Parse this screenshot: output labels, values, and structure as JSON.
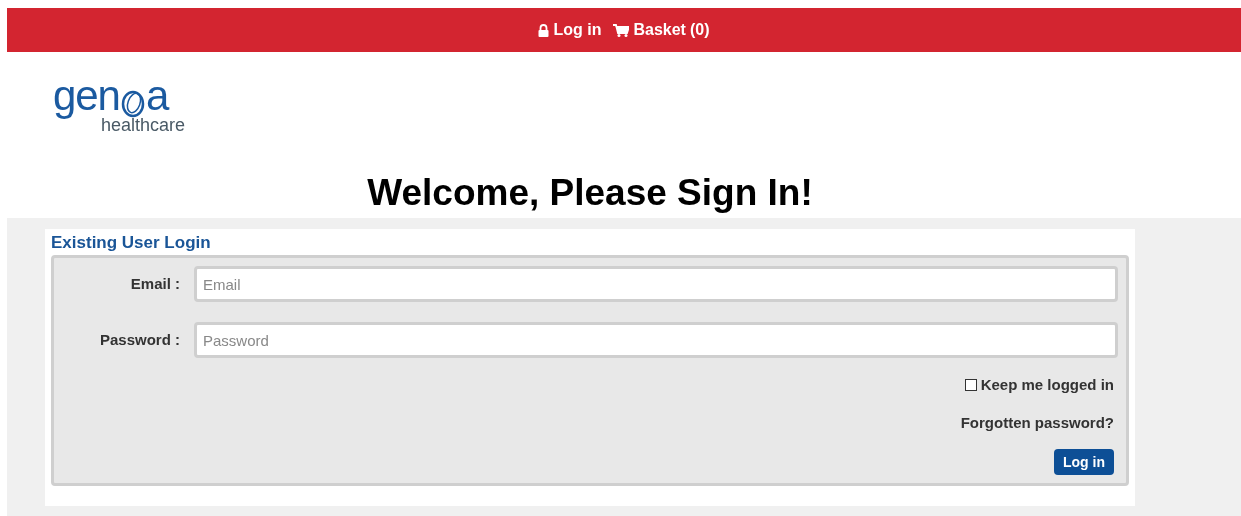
{
  "top_bar": {
    "login": "Log in",
    "basket": "Basket",
    "basket_count": "(0)"
  },
  "logo": {
    "word_start": "gen",
    "word_end": "a",
    "tagline": "healthcare"
  },
  "heading": "Welcome, Please Sign In!",
  "login_panel": {
    "title": "Existing User Login",
    "fields": [
      {
        "label": "Email :",
        "placeholder": "Email"
      },
      {
        "label": "Password :",
        "placeholder": "Password"
      }
    ],
    "remember": {
      "label": "Keep me logged in",
      "checked": false
    },
    "forgot": "Forgotten password?",
    "submit": "Log in"
  }
}
